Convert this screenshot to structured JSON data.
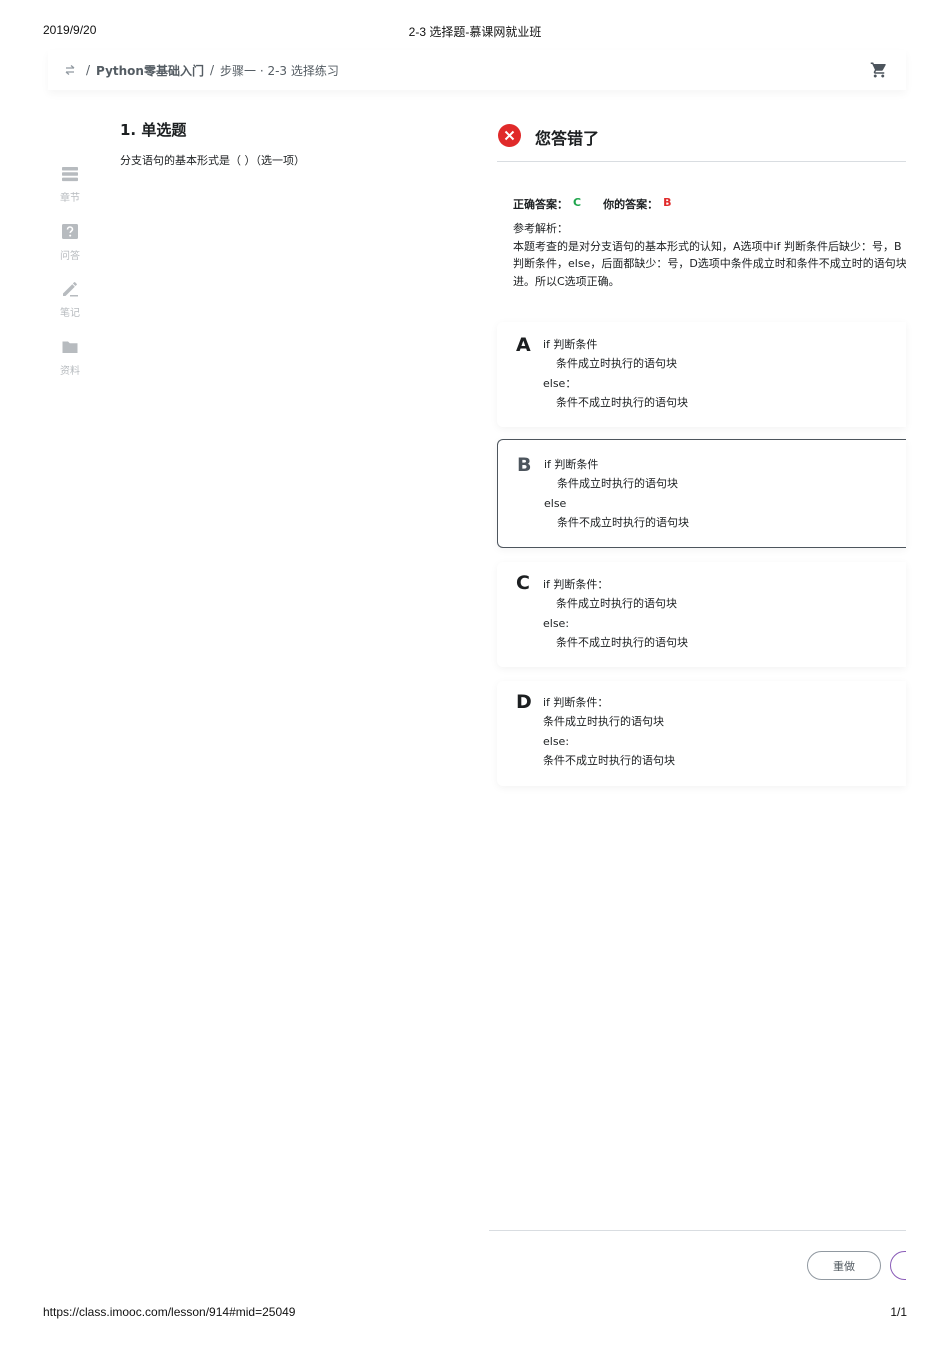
{
  "print_header": {
    "date": "2019/9/20",
    "title": "2-3 选择题-慕课网就业班"
  },
  "print_footer": {
    "url": "https://class.imooc.com/lesson/914#mid=25049",
    "page": "1/1"
  },
  "breadcrumb": {
    "course": "Python零基础入门",
    "lesson": "步骤一 · 2-3 选择练习"
  },
  "sidenav": {
    "items": [
      {
        "label": "章节",
        "icon": "chapter-icon"
      },
      {
        "label": "问答",
        "icon": "question-icon"
      },
      {
        "label": "笔记",
        "icon": "note-pencil-icon"
      },
      {
        "label": "资料",
        "icon": "folder-icon"
      }
    ]
  },
  "question": {
    "title": "1. 单选题",
    "text": "分支语句的基本形式是（ ）（选一项）"
  },
  "result": {
    "status": "您答错了",
    "correct_label": "正确答案：",
    "correct_value": "C",
    "your_label": "你的答案：",
    "your_value": "B",
    "analysis_label": "参考解析：",
    "analysis_lines": [
      "本题考查的是对分支语句的基本形式的认知，A选项中if 判断条件后缺少：号，B",
      "判断条件，else，后面都缺少：号，D选项中条件成立时和条件不成立时的语句块",
      "进。所以C选项正确。"
    ]
  },
  "options": [
    {
      "letter": "A",
      "lines": [
        "if 判断条件",
        "条件成立时执行的语句块",
        "else：",
        "条件不成立时执行的语句块"
      ]
    },
    {
      "letter": "B",
      "lines": [
        "if 判断条件",
        "条件成立时执行的语句块",
        "else",
        "条件不成立时执行的语句块"
      ]
    },
    {
      "letter": "C",
      "lines": [
        "if 判断条件：",
        "条件成立时执行的语句块",
        "else:",
        "条件不成立时执行的语句块"
      ]
    },
    {
      "letter": "D",
      "lines": [
        "if 判断条件：",
        "条件成立时执行的语句块",
        "else:",
        "条件不成立时执行的语句块"
      ]
    }
  ],
  "actions": {
    "redo": "重做"
  },
  "colors": {
    "correct": "#1fa54c",
    "wrong": "#e02a2a",
    "selected_border": "#4d555d"
  }
}
